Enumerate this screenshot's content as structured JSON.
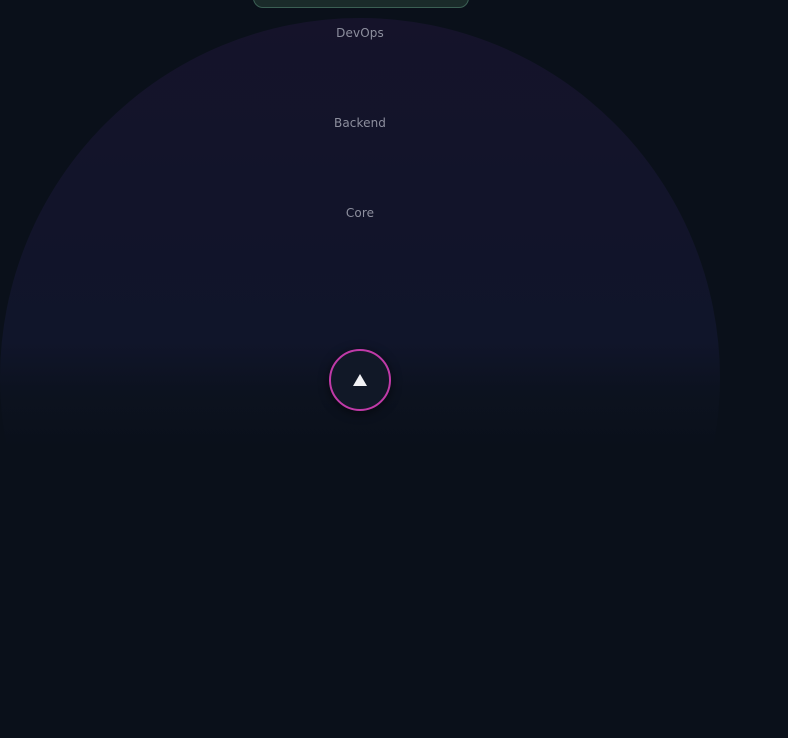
{
  "radar": {
    "rings": [
      {
        "label": "DevOps"
      },
      {
        "label": "Backend"
      },
      {
        "label": "Core"
      }
    ],
    "center_icon": "triangle-up-icon",
    "accent_color": "#c03aa8",
    "background_color": "#0a101a",
    "top_pill_color": "#1a2b2a",
    "top_pill_border": "#3b5f54"
  }
}
